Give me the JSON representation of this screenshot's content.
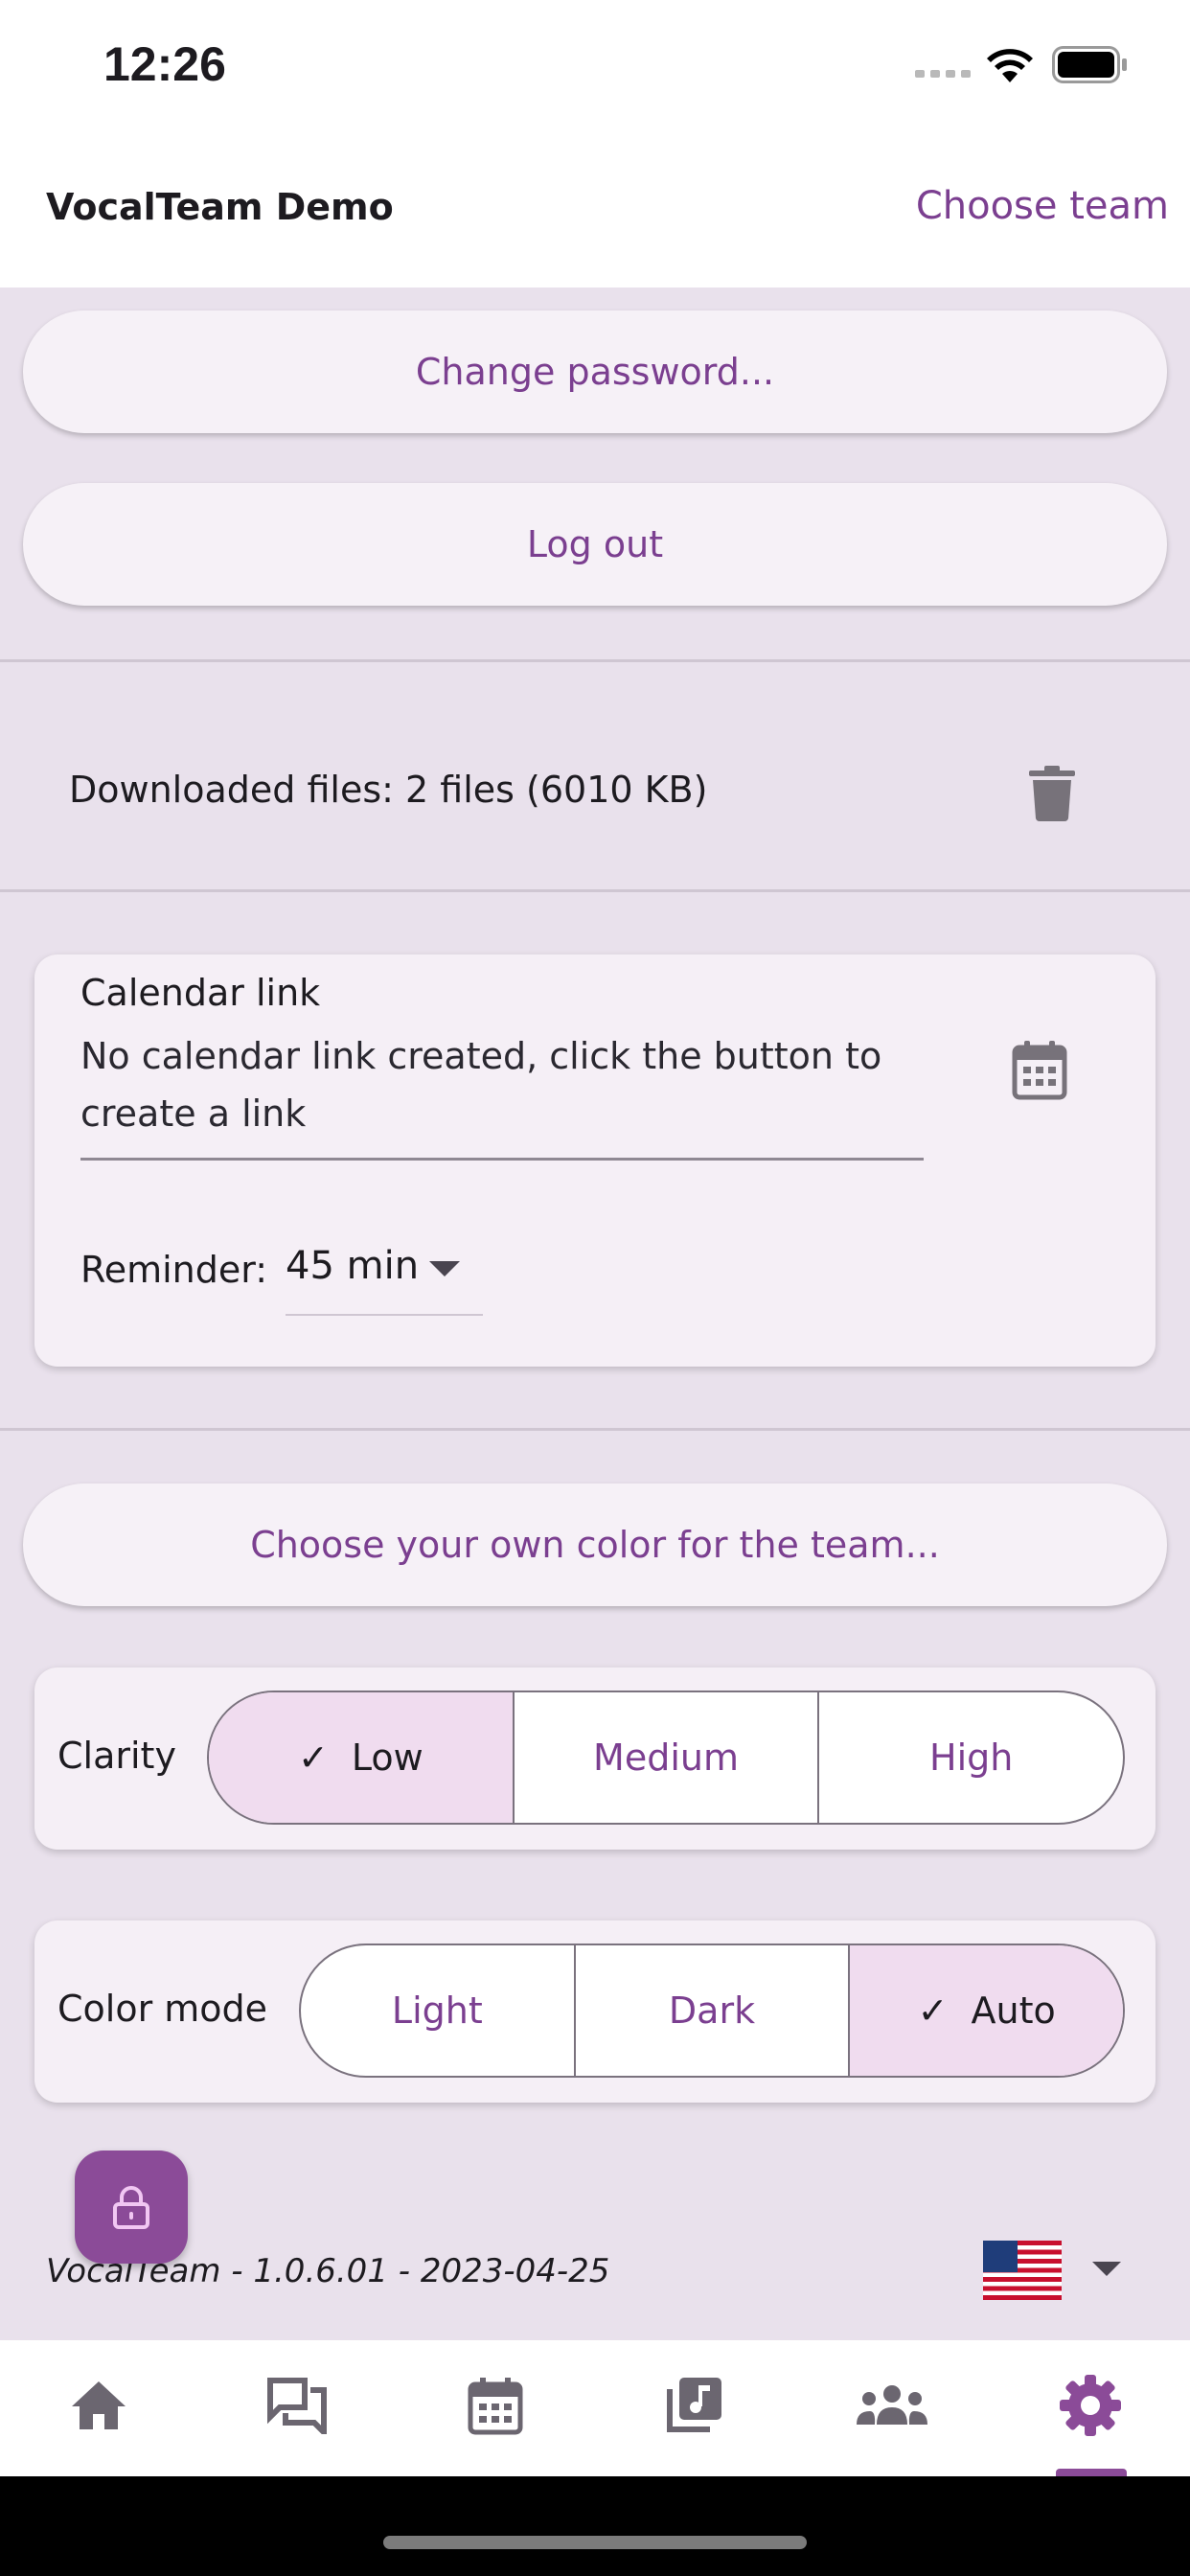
{
  "status_bar": {
    "time": "12:26"
  },
  "header": {
    "title": "VocalTeam Demo",
    "choose_team": "Choose team"
  },
  "account": {
    "change_password": "Change password...",
    "log_out": "Log out"
  },
  "downloads": {
    "text": "Downloaded files: 2 files (6010 KB)"
  },
  "calendar": {
    "label": "Calendar link",
    "text": "No calendar link created, click the button to create a link",
    "reminder_label": "Reminder:",
    "reminder_value": "45 min"
  },
  "team_color_button": "Choose your own color for the team...",
  "clarity": {
    "label": "Clarity",
    "options": [
      "Low",
      "Medium",
      "High"
    ],
    "selected": "Low"
  },
  "color_mode": {
    "label": "Color mode",
    "options": [
      "Light",
      "Dark",
      "Auto"
    ],
    "selected": "Auto"
  },
  "footer": {
    "version": "VocalTeam - 1.0.6.01 - 2023-04-25",
    "language_flag": "us-flag-icon"
  },
  "bottom_nav": [
    "home-icon",
    "chat-icon",
    "calendar-icon",
    "music-library-icon",
    "group-icon",
    "settings-icon"
  ],
  "colors": {
    "accent": "#7b3f90",
    "background": "#e9e1ec",
    "selected_segment": "#f0dcef"
  }
}
